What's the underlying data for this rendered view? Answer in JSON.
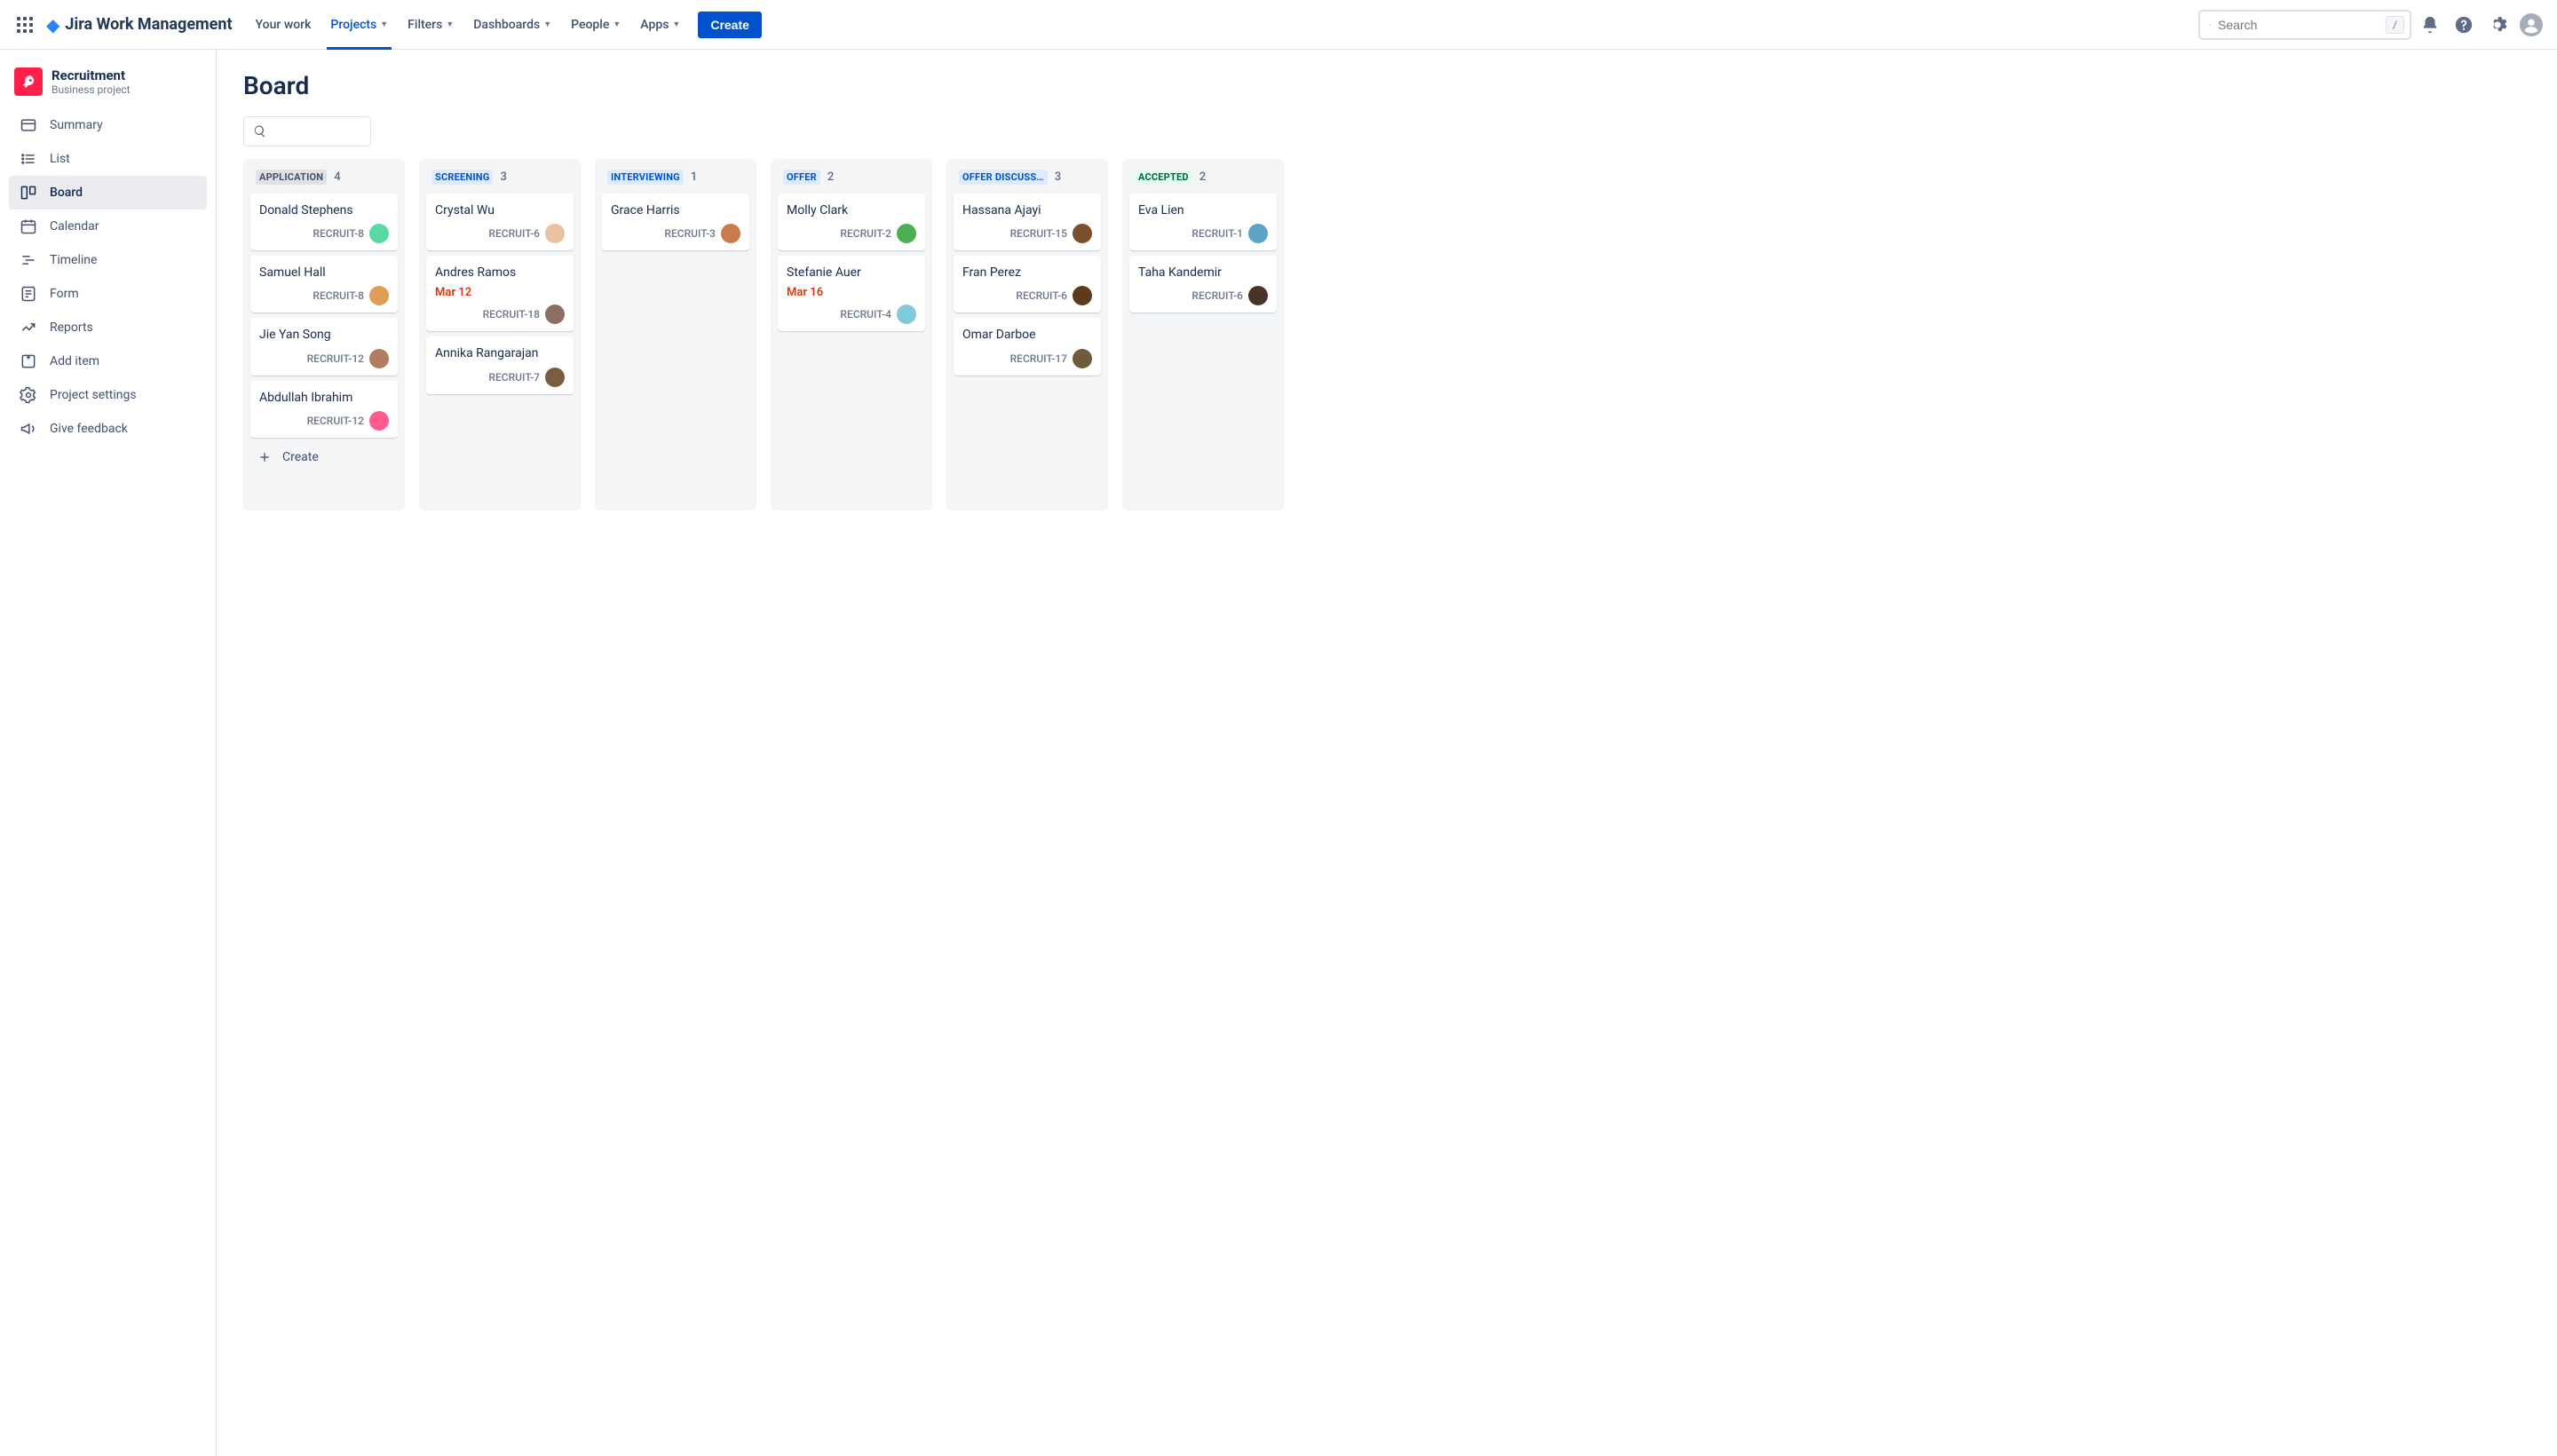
{
  "brand": "Jira Work Management",
  "nav": {
    "your_work": "Your work",
    "projects": "Projects",
    "filters": "Filters",
    "dashboards": "Dashboards",
    "people": "People",
    "apps": "Apps",
    "create": "Create"
  },
  "search": {
    "placeholder": "Search",
    "shortcut": "/"
  },
  "project": {
    "name": "Recruitment",
    "type": "Business project"
  },
  "sidebar": {
    "summary": "Summary",
    "list": "List",
    "board": "Board",
    "calendar": "Calendar",
    "timeline": "Timeline",
    "form": "Form",
    "reports": "Reports",
    "add_item": "Add item",
    "settings": "Project settings",
    "feedback": "Give feedback"
  },
  "page": {
    "title": "Board",
    "create_label": "Create"
  },
  "columns": [
    {
      "id": "application",
      "label": "APPLICATION",
      "count": "4",
      "color": "#42526E",
      "bg": "#DFE1E6",
      "cards": [
        {
          "title": "Donald Stephens",
          "key": "RECRUIT-8",
          "avatar": "#57D9A3"
        },
        {
          "title": "Samuel Hall",
          "key": "RECRUIT-8",
          "avatar": "#DE9E55"
        },
        {
          "title": "Jie Yan Song",
          "key": "RECRUIT-12",
          "avatar": "#B07D62"
        },
        {
          "title": "Abdullah Ibrahim",
          "key": "RECRUIT-12",
          "avatar": "#FF5B8F"
        }
      ],
      "show_create": true
    },
    {
      "id": "screening",
      "label": "SCREENING",
      "count": "3",
      "color": "#0052CC",
      "bg": "#DEEBFF",
      "cards": [
        {
          "title": "Crystal Wu",
          "key": "RECRUIT-6",
          "avatar": "#E8C1A0"
        },
        {
          "title": "Andres Ramos",
          "date": "Mar 12",
          "key": "RECRUIT-18",
          "avatar": "#8D6E63"
        },
        {
          "title": "Annika Rangarajan",
          "key": "RECRUIT-7",
          "avatar": "#7A5C3E"
        }
      ]
    },
    {
      "id": "interviewing",
      "label": "INTERVIEWING",
      "count": "1",
      "color": "#0052CC",
      "bg": "#DEEBFF",
      "cards": [
        {
          "title": "Grace Harris",
          "key": "RECRUIT-3",
          "avatar": "#C97B4E"
        }
      ]
    },
    {
      "id": "offer",
      "label": "OFFER",
      "count": "2",
      "color": "#0052CC",
      "bg": "#DEEBFF",
      "cards": [
        {
          "title": "Molly Clark",
          "key": "RECRUIT-2",
          "avatar": "#4CAF50"
        },
        {
          "title": "Stefanie Auer",
          "date": "Mar 16",
          "key": "RECRUIT-4",
          "avatar": "#81C9D9"
        }
      ]
    },
    {
      "id": "offer_discussion",
      "label": "OFFER DISCUSS…",
      "count": "3",
      "color": "#0052CC",
      "bg": "#DEEBFF",
      "cards": [
        {
          "title": "Hassana Ajayi",
          "key": "RECRUIT-15",
          "avatar": "#7B4F2C"
        },
        {
          "title": "Fran Perez",
          "key": "RECRUIT-6",
          "avatar": "#5D3A1A"
        },
        {
          "title": "Omar Darboe",
          "key": "RECRUIT-17",
          "avatar": "#6D5B3E"
        }
      ]
    },
    {
      "id": "accepted",
      "label": "ACCEPTED",
      "count": "2",
      "color": "#006644",
      "bg": "#E3FCEF",
      "cards": [
        {
          "title": "Eva Lien",
          "key": "RECRUIT-1",
          "avatar": "#5BA3C7"
        },
        {
          "title": "Taha Kandemir",
          "key": "RECRUIT-6",
          "avatar": "#4A342A"
        }
      ]
    }
  ]
}
